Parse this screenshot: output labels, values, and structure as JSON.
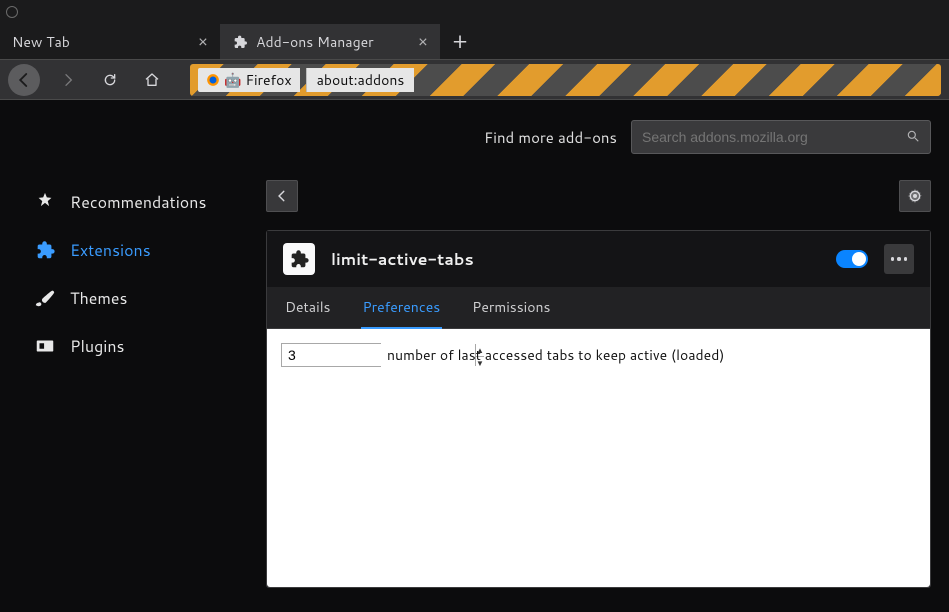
{
  "tabs": {
    "items": [
      {
        "title": "New Tab"
      },
      {
        "title": "Add-ons Manager"
      }
    ]
  },
  "urlbar": {
    "identity_label": "Firefox",
    "path": "about:addons"
  },
  "find": {
    "label": "Find more add-ons",
    "placeholder": "Search addons.mozilla.org"
  },
  "sidebar": {
    "items": [
      {
        "label": "Recommendations"
      },
      {
        "label": "Extensions"
      },
      {
        "label": "Themes"
      },
      {
        "label": "Plugins"
      }
    ]
  },
  "extension": {
    "name": "limit-active-tabs",
    "enabled": true,
    "tabs": [
      {
        "label": "Details"
      },
      {
        "label": "Preferences"
      },
      {
        "label": "Permissions"
      }
    ],
    "pref_value": "3",
    "pref_label": "number of last accessed tabs to keep active (loaded)"
  }
}
